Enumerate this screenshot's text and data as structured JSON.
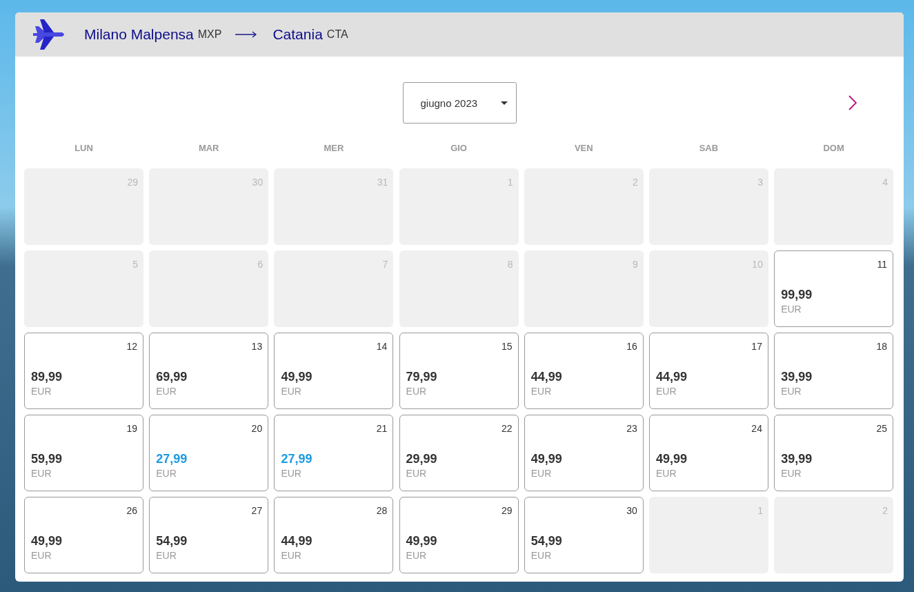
{
  "route": {
    "origin": {
      "city": "Milano Malpensa",
      "code": "MXP"
    },
    "destination": {
      "city": "Catania",
      "code": "CTA"
    }
  },
  "month_select": {
    "value": "giugno 2023"
  },
  "weekdays": [
    "LUN",
    "MAR",
    "MER",
    "GIO",
    "VEN",
    "SAB",
    "DOM"
  ],
  "days": [
    {
      "day": "29",
      "available": false
    },
    {
      "day": "30",
      "available": false
    },
    {
      "day": "31",
      "available": false
    },
    {
      "day": "1",
      "available": false
    },
    {
      "day": "2",
      "available": false
    },
    {
      "day": "3",
      "available": false
    },
    {
      "day": "4",
      "available": false
    },
    {
      "day": "5",
      "available": false
    },
    {
      "day": "6",
      "available": false
    },
    {
      "day": "7",
      "available": false
    },
    {
      "day": "8",
      "available": false
    },
    {
      "day": "9",
      "available": false
    },
    {
      "day": "10",
      "available": false
    },
    {
      "day": "11",
      "available": true,
      "price": "99,99",
      "currency": "EUR",
      "lowest": false
    },
    {
      "day": "12",
      "available": true,
      "price": "89,99",
      "currency": "EUR",
      "lowest": false
    },
    {
      "day": "13",
      "available": true,
      "price": "69,99",
      "currency": "EUR",
      "lowest": false
    },
    {
      "day": "14",
      "available": true,
      "price": "49,99",
      "currency": "EUR",
      "lowest": false
    },
    {
      "day": "15",
      "available": true,
      "price": "79,99",
      "currency": "EUR",
      "lowest": false
    },
    {
      "day": "16",
      "available": true,
      "price": "44,99",
      "currency": "EUR",
      "lowest": false
    },
    {
      "day": "17",
      "available": true,
      "price": "44,99",
      "currency": "EUR",
      "lowest": false
    },
    {
      "day": "18",
      "available": true,
      "price": "39,99",
      "currency": "EUR",
      "lowest": false
    },
    {
      "day": "19",
      "available": true,
      "price": "59,99",
      "currency": "EUR",
      "lowest": false
    },
    {
      "day": "20",
      "available": true,
      "price": "27,99",
      "currency": "EUR",
      "lowest": true
    },
    {
      "day": "21",
      "available": true,
      "price": "27,99",
      "currency": "EUR",
      "lowest": true
    },
    {
      "day": "22",
      "available": true,
      "price": "29,99",
      "currency": "EUR",
      "lowest": false
    },
    {
      "day": "23",
      "available": true,
      "price": "49,99",
      "currency": "EUR",
      "lowest": false
    },
    {
      "day": "24",
      "available": true,
      "price": "49,99",
      "currency": "EUR",
      "lowest": false
    },
    {
      "day": "25",
      "available": true,
      "price": "39,99",
      "currency": "EUR",
      "lowest": false
    },
    {
      "day": "26",
      "available": true,
      "price": "49,99",
      "currency": "EUR",
      "lowest": false
    },
    {
      "day": "27",
      "available": true,
      "price": "54,99",
      "currency": "EUR",
      "lowest": false
    },
    {
      "day": "28",
      "available": true,
      "price": "44,99",
      "currency": "EUR",
      "lowest": false
    },
    {
      "day": "29",
      "available": true,
      "price": "49,99",
      "currency": "EUR",
      "lowest": false
    },
    {
      "day": "30",
      "available": true,
      "price": "54,99",
      "currency": "EUR",
      "lowest": false
    },
    {
      "day": "1",
      "available": false
    },
    {
      "day": "2",
      "available": false
    }
  ]
}
